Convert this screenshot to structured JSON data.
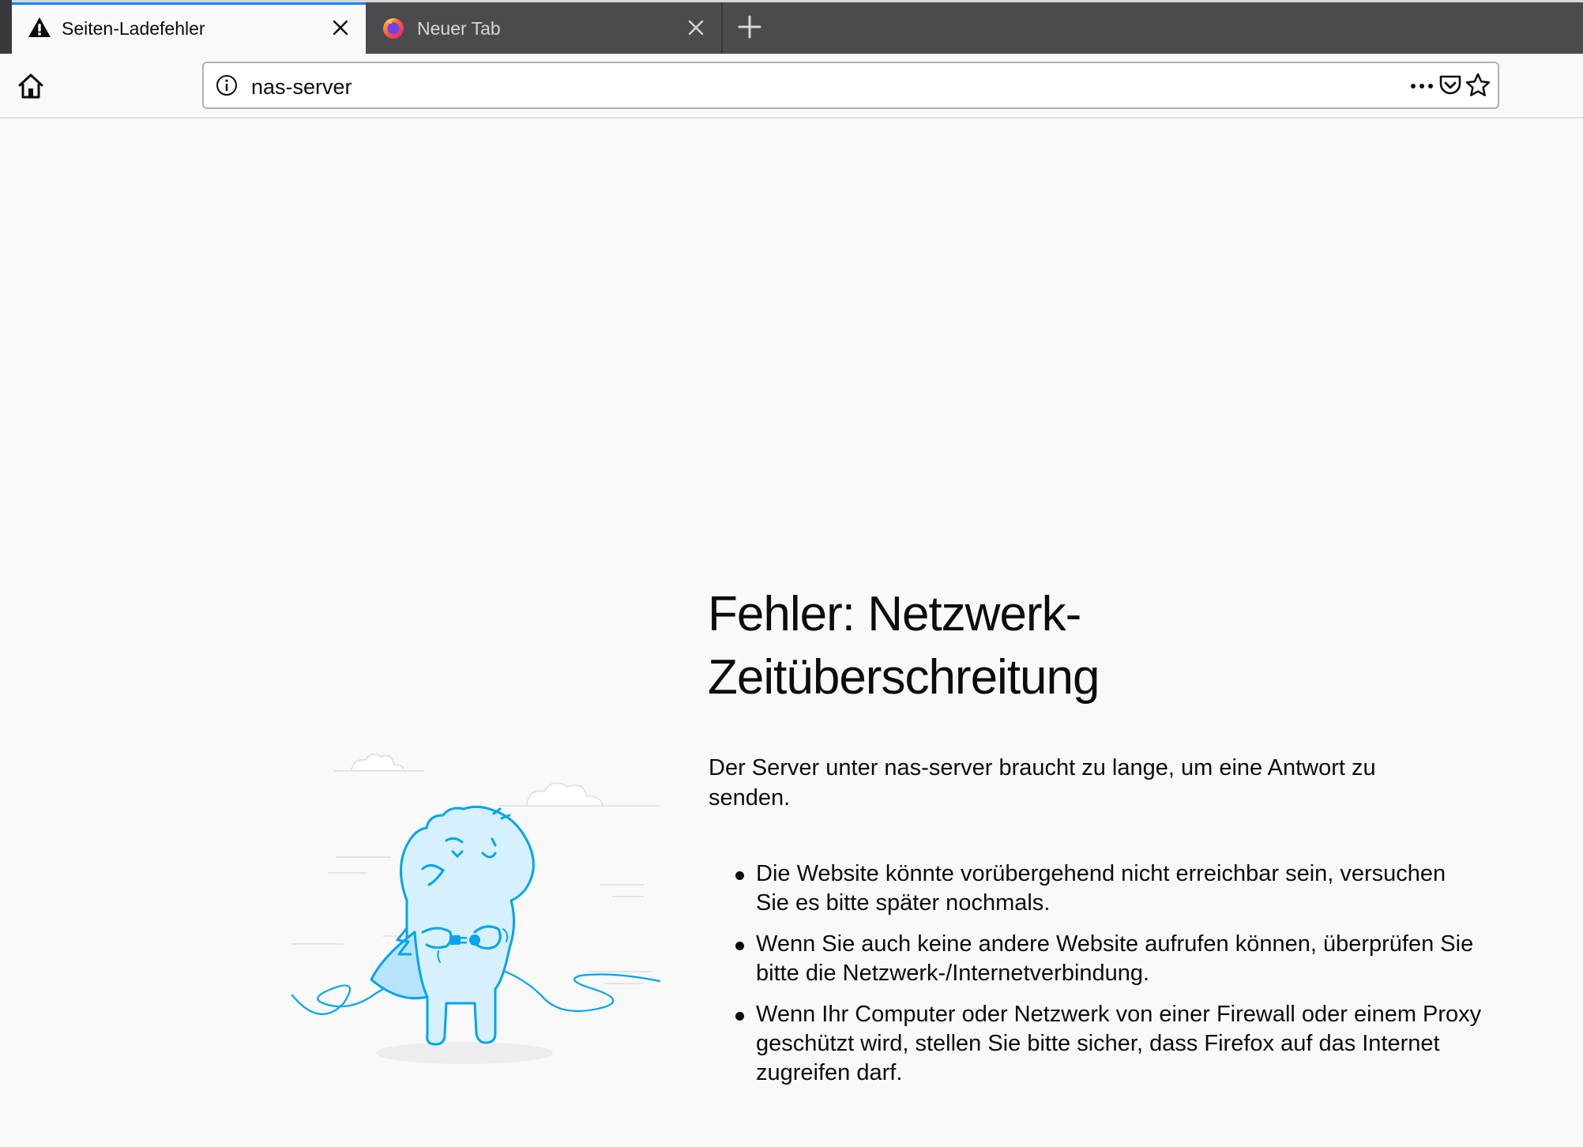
{
  "tabs": [
    {
      "label": "Seiten-Ladefehler",
      "icon": "warning-icon",
      "active": true
    },
    {
      "label": "Neuer Tab",
      "icon": "firefox-icon",
      "active": false
    }
  ],
  "toolbar": {
    "url": "nas-server"
  },
  "error": {
    "title_line1": "Fehler: Netzwerk-",
    "title_line2": "Zeitüberschreitung",
    "description": "Der Server unter nas-server braucht zu lange, um eine Antwort zu senden.",
    "suggestions": [
      "Die Website könnte vorübergehend nicht erreichbar sein, versuchen Sie es bitte später nochmals.",
      "Wenn Sie auch keine andere Website aufrufen können, überprüfen Sie bitte die Netzwerk-/Internetverbindung.",
      "Wenn Ihr Computer oder Netzwerk von einer Firewall oder einem Proxy geschützt wird, stellen Sie bitte sicher, dass Firefox auf das Internet zugreifen darf."
    ]
  },
  "colors": {
    "accent": "#0a84ff",
    "illustration": "#00a4f0",
    "tabstrip": "#4a4a4f"
  }
}
